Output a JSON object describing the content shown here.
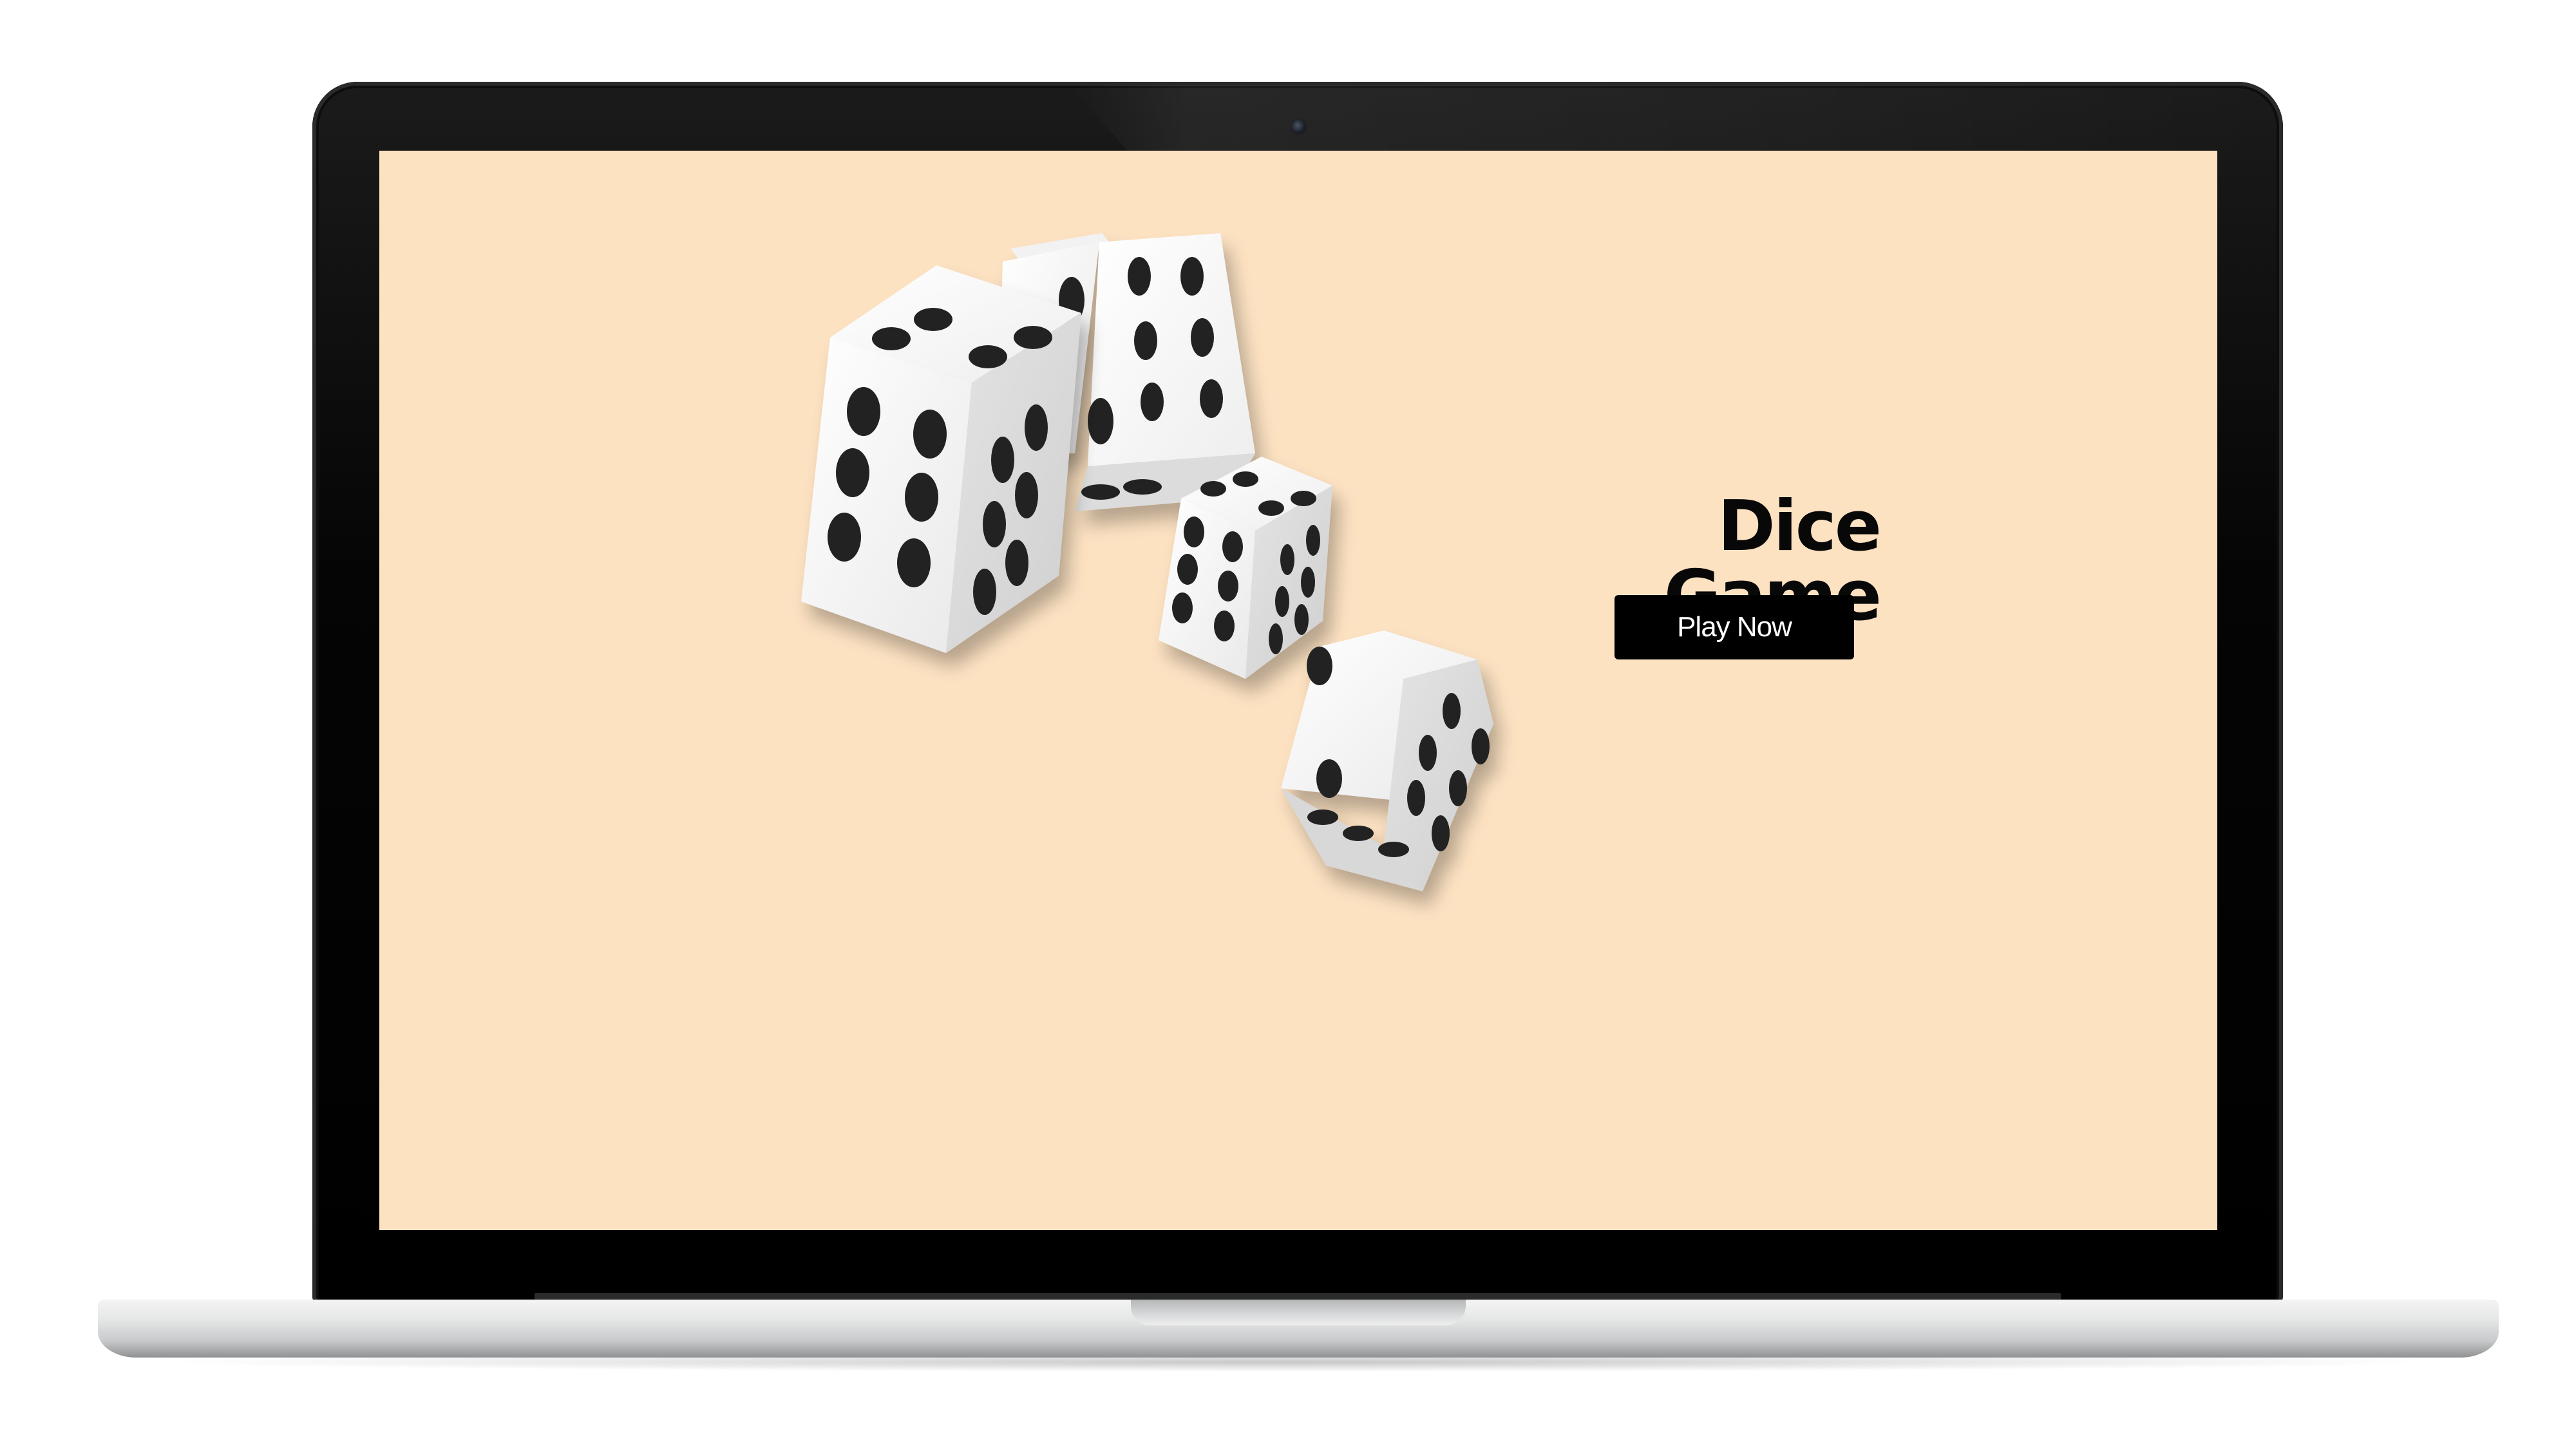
{
  "page": {
    "title": "Dice Game",
    "play_button_label": "Play Now",
    "background_color": "#fde2c2",
    "button_color": "#000000"
  },
  "illustration": {
    "description_icon": "dice-icon",
    "dice_count": 4
  }
}
